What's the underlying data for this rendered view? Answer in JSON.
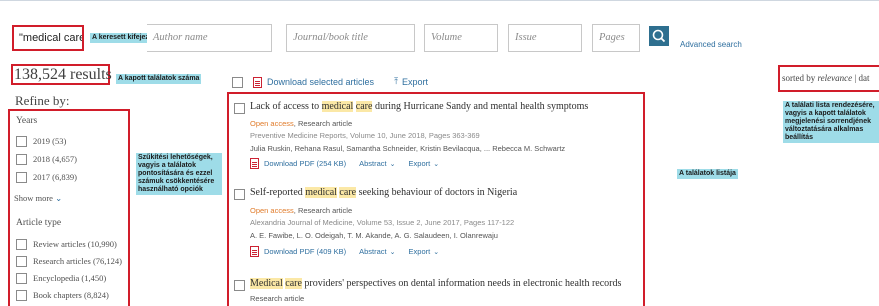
{
  "search": {
    "keywords_value": "\"medical care\"",
    "author_placeholder": "Author name",
    "journal_placeholder": "Journal/book title",
    "volume_placeholder": "Volume",
    "issue_placeholder": "Issue",
    "pages_placeholder": "Pages",
    "advanced_link": "Advanced search",
    "button_icon": "search-icon"
  },
  "annotations": {
    "keywords": "A keresett kifejezés",
    "count": "A kapott találatok száma",
    "refine": "Szűkítési lehetőségek, vagyis a találatok pontosítására és ezzel számuk csökkentésére használható opciók",
    "list": "A találatok listája",
    "sort": "A találati lista rendezésére, vagyis a kapott találatok megjelenési sorrendjének változtatására alkalmas beállítás"
  },
  "results": {
    "count": "138,524 results"
  },
  "refine": {
    "title": "Refine by:",
    "years_title": "Years",
    "years": [
      {
        "label": "2019 (53)"
      },
      {
        "label": "2018 (4,657)"
      },
      {
        "label": "2017 (6,839)"
      }
    ],
    "show_more": "Show more",
    "article_type_title": "Article type",
    "article_types": [
      {
        "label": "Review articles (10,990)"
      },
      {
        "label": "Research articles (76,124)"
      },
      {
        "label": "Encyclopedia (1,450)"
      },
      {
        "label": "Book chapters (8,824)"
      }
    ]
  },
  "toolbar": {
    "download_selected": "Download selected articles",
    "export": "Export"
  },
  "sort": {
    "label": "sorted by",
    "value": "relevance",
    "sep": " | ",
    "alt": "dat"
  },
  "articles": [
    {
      "title_pre": "Lack of access to ",
      "title_hl1": "medical",
      "title_mid": " ",
      "title_hl2": "care",
      "title_post": " during Hurricane Sandy and mental health symptoms",
      "access": "Open access",
      "type": "Research article",
      "source": "Preventive Medicine Reports, Volume 10, June 2018, Pages 363-369",
      "authors": "Julia Ruskin, Rehana Rasul, Samantha Schneider, Kristin Bevilacqua, ... Rebecca M. Schwartz",
      "pdf": "Download PDF (254 KB)",
      "abstract": "Abstract",
      "export": "Export"
    },
    {
      "title_pre": "Self-reported ",
      "title_hl1": "medical",
      "title_mid": " ",
      "title_hl2": "care",
      "title_post": " seeking behaviour of doctors in Nigeria",
      "access": "Open access",
      "type": "Research article",
      "source": "Alexandria Journal of Medicine, Volume 53, Issue 2, June 2017, Pages 117-122",
      "authors": "A. E. Fawibe, L. O. Odeigah, T. M. Akande, A. G. Salaudeen, I. Olanrewaju",
      "pdf": "Download PDF (409 KB)",
      "abstract": "Abstract",
      "export": "Export"
    },
    {
      "title_pre": "",
      "title_hl1": "Medical",
      "title_mid": " ",
      "title_hl2": "care",
      "title_post": " providers' perspectives on dental information needs in electronic health records",
      "type": "Research article"
    }
  ],
  "colors": {
    "highlight_box": "#d11d2a",
    "annotation_bg": "#9edce8",
    "link": "#2f6f9f",
    "open_access": "#e07b2a",
    "keyword_highlight": "#fbe8a6"
  }
}
